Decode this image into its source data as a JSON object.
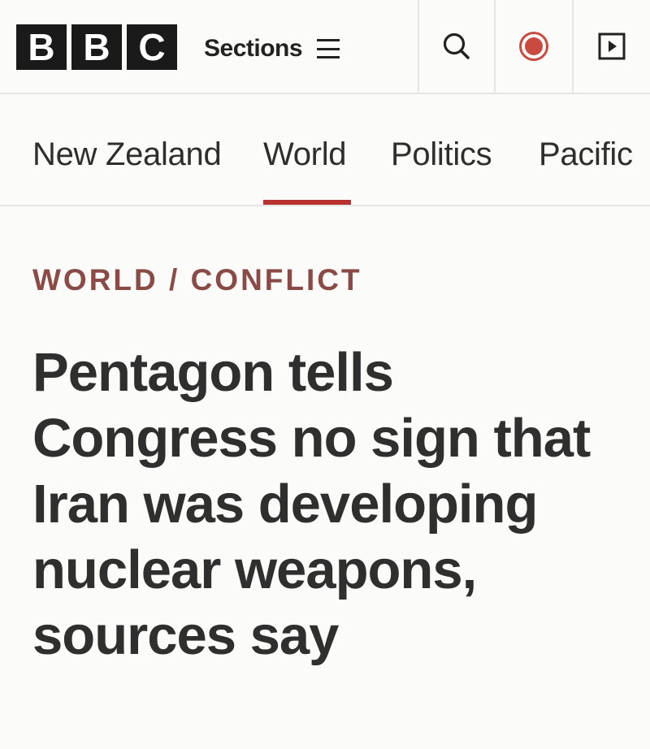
{
  "header": {
    "logo_letters": [
      "B",
      "B",
      "C"
    ],
    "sections_label": "Sections",
    "icons": {
      "menu": "hamburger-menu-icon",
      "search": "search-icon",
      "live": "live-record-icon",
      "play": "play-icon"
    },
    "live_color": "#c94b3f"
  },
  "nav": {
    "items": [
      "New Zealand",
      "World",
      "Politics",
      "Pacific"
    ],
    "active": "World",
    "active_color": "#b8312f"
  },
  "article": {
    "kicker": "WORLD / CONFLICT",
    "headline": "Pentagon tells Congress no sign that Iran was developing nuclear weapons, sources say"
  }
}
